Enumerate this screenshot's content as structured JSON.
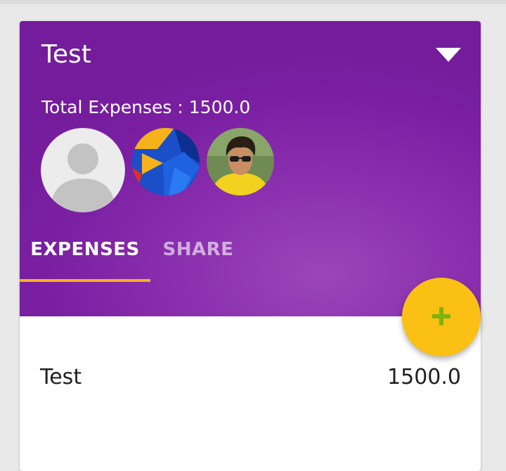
{
  "header": {
    "title": "Test",
    "total_label": "Total Expenses : 1500.0",
    "accent_color": "#7b1fa2"
  },
  "tabs": [
    {
      "label": "EXPENSES",
      "selected": true
    },
    {
      "label": "SHARE",
      "selected": false
    }
  ],
  "tab_indicator_color": "#f6b21a",
  "expenses": [
    {
      "name": "Test",
      "amount": "1500.0"
    }
  ],
  "fab": {
    "icon": "plus-icon",
    "color": "#fbc014"
  },
  "members": [
    {
      "avatar": "default-person-avatar"
    },
    {
      "avatar": "logo-avatar"
    },
    {
      "avatar": "photo-avatar"
    }
  ]
}
